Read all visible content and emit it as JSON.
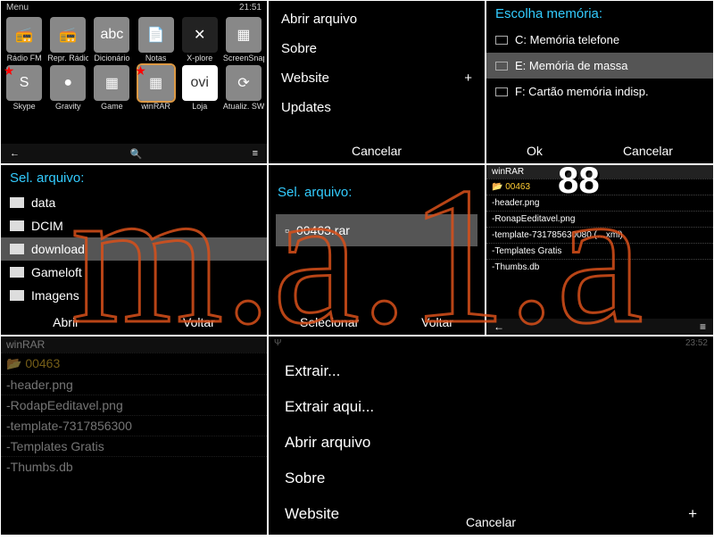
{
  "statusbar": {
    "left": "Menu",
    "right": "21:51"
  },
  "apps": {
    "row1": [
      {
        "label": "Rádio FM"
      },
      {
        "label": "Repr. Rádio"
      },
      {
        "label": "Dicionário"
      },
      {
        "label": "Notas"
      },
      {
        "label": "X-plore"
      },
      {
        "label": "ScreenSnap"
      }
    ],
    "row2": [
      {
        "label": "Skype"
      },
      {
        "label": "Gravity"
      },
      {
        "label": "Game"
      },
      {
        "label": "winRAR"
      },
      {
        "label": "Loja"
      },
      {
        "label": "Atualiz. SW"
      }
    ]
  },
  "bottombar": {
    "back": "←",
    "search": "🔍",
    "menu": "≡"
  },
  "menu2": {
    "items": [
      "Abrir arquivo",
      "Sobre",
      "Website",
      "Updates"
    ],
    "cancel": "Cancelar",
    "plus": "+"
  },
  "panel3": {
    "title": "Escolha  memória:",
    "items": [
      "C: Memória telefone",
      "E: Memória de massa",
      "F: Cartão memória indisp."
    ],
    "ok": "Ok",
    "cancel": "Cancelar"
  },
  "panel4": {
    "title": "Sel. arquivo:",
    "items": [
      "data",
      "DCIM",
      "download",
      "Gameloft",
      "Imagens"
    ],
    "open": "Abrir",
    "back": "Voltar"
  },
  "panel5": {
    "title": "Sel. arquivo:",
    "file": "00463.rar",
    "select": "Selecionar",
    "back": "Voltar"
  },
  "panel6": {
    "title": "winRAR",
    "folder": "📂 00463",
    "files": [
      "-header.png",
      "-RonapEeditavel.png",
      "-template-731785630080 (…xml)",
      "-Templates Gratis",
      "-Thumbs.db"
    ],
    "big": "88"
  },
  "panel7": {
    "title": "winRAR",
    "folder": "📂 00463",
    "files": [
      "-header.png",
      "-RodapEeditavel.png",
      "-template-7317856300",
      "-Templates Gratis",
      "-Thumbs.db"
    ]
  },
  "panel8": {
    "status_time": "23:52",
    "items": [
      "Extrair...",
      "Extrair aqui...",
      "Abrir arquivo",
      "Sobre",
      "Website"
    ],
    "cancel": "Cancelar",
    "plus": "+"
  },
  "watermark_text": "m.a.1.a",
  "chart_data": null
}
